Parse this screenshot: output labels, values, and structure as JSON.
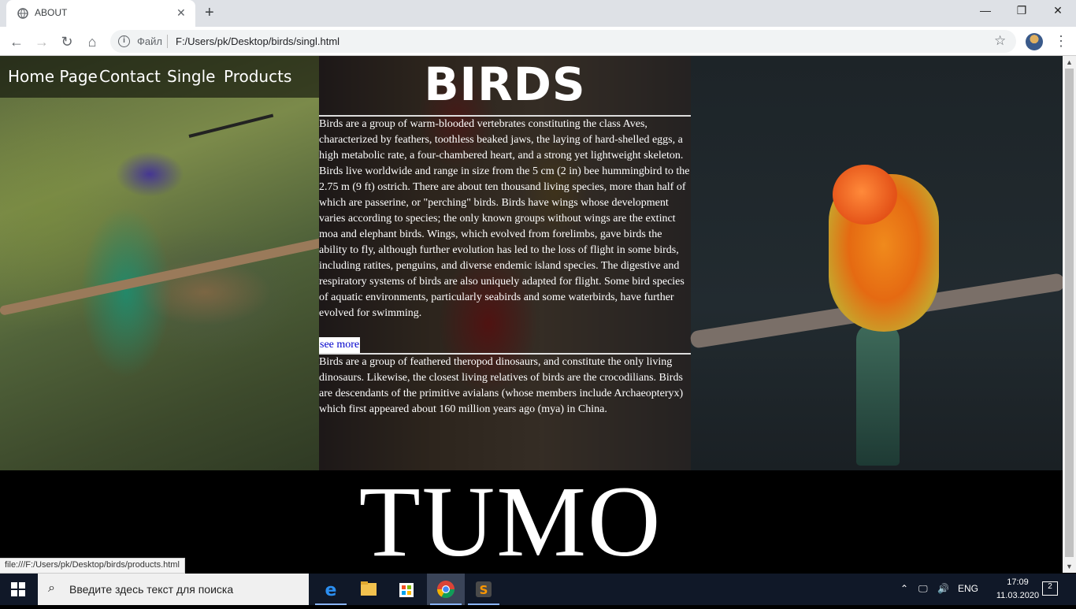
{
  "browser": {
    "tab_title": "ABOUT",
    "tab_close": "✕",
    "new_tab": "+",
    "scheme": "Файл",
    "url": "F:/Users/pk/Desktop/birds/singl.html",
    "status_url": "file:///F:/Users/pk/Desktop/birds/products.html",
    "window_controls": {
      "minimize": "—",
      "maximize": "❐",
      "close": "✕"
    }
  },
  "nav": {
    "items": [
      {
        "label": "Home Page"
      },
      {
        "label": "Contact"
      },
      {
        "label": "Single"
      },
      {
        "label": "Products"
      }
    ]
  },
  "page": {
    "title": "BIRDS",
    "paragraph1": "Birds are a group of warm-blooded vertebrates constituting the class Aves, characterized by feathers, toothless beaked jaws, the laying of hard-shelled eggs, a high metabolic rate, a four-chambered heart, and a strong yet lightweight skeleton. Birds live worldwide and range in size from the 5 cm (2 in) bee hummingbird to the 2.75 m (9 ft) ostrich. There are about ten thousand living species, more than half of which are passerine, or \"perching\" birds. Birds have wings whose development varies according to species; the only known groups without wings are the extinct moa and elephant birds. Wings, which evolved from forelimbs, gave birds the ability to fly, although further evolution has led to the loss of flight in some birds, including ratites, penguins, and diverse endemic island species. The digestive and respiratory systems of birds are also uniquely adapted for flight. Some bird species of aquatic environments, particularly seabirds and some waterbirds, have further evolved for swimming.",
    "see_more": "see more",
    "paragraph2": "Birds are a group of feathered theropod dinosaurs, and constitute the only living dinosaurs. Likewise, the closest living relatives of birds are the crocodilians. Birds are descendants of the primitive avialans (whose members include Archaeopteryx) which first appeared about 160 million years ago (mya) in China.",
    "footer_title": "TUMO"
  },
  "taskbar": {
    "search_placeholder": "Введите здесь текст для поиска",
    "language": "ENG",
    "time": "17:09",
    "date": "11.03.2020",
    "notifications": "2"
  },
  "colors": {
    "taskbar": "#101828",
    "link": "#0000cc"
  }
}
